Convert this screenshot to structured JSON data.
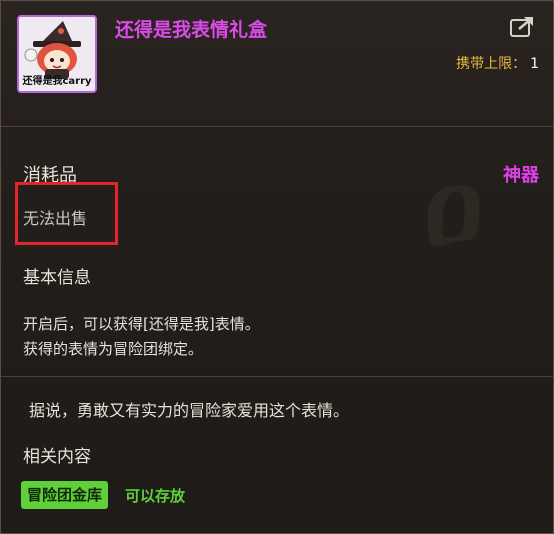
{
  "item": {
    "title": "还得是我表情礼盒",
    "icon_caption": "还得是我carry",
    "carry_limit_label": "携带上限：",
    "carry_limit_value": "1",
    "category": "消耗品",
    "rarity": "神器",
    "rarity_color": "#e040e8",
    "sell_status": "无法出售"
  },
  "basic_info": {
    "heading": "基本信息",
    "lines": [
      "开启后，可以获得[还得是我]表情。",
      "获得的表情为冒险团绑定。"
    ]
  },
  "flavor_text": "据说，勇敢又有实力的冒险家爱用这个表情。",
  "related": {
    "heading": "相关内容",
    "storage_label": "冒险团金库",
    "storage_status": "可以存放"
  },
  "highlight": {
    "color": "#e3262a"
  }
}
